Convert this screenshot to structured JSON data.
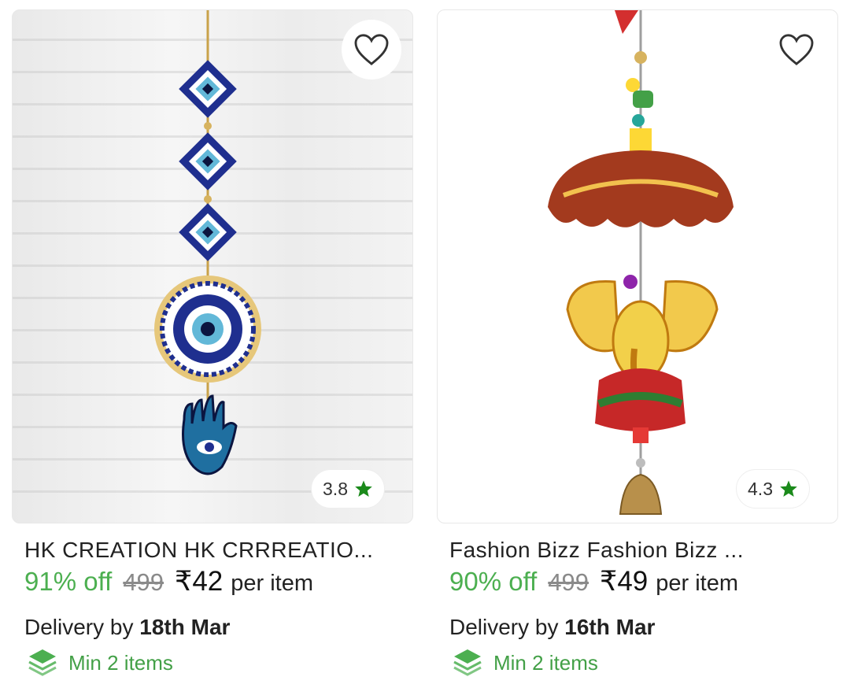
{
  "products": [
    {
      "title": "HK CREATION HK CRRREATIO...",
      "rating": "3.8",
      "discount": "91% off",
      "mrp": "499",
      "price": "₹42",
      "unit": "per item",
      "delivery_prefix": "Delivery by",
      "delivery_date": "18th Mar",
      "min_items": "Min 2 items",
      "image_icon": "evil-eye-hanging-image"
    },
    {
      "title": "Fashion Bizz Fashion Bizz ...",
      "rating": "4.3",
      "discount": "90% off",
      "mrp": "499",
      "price": "₹49",
      "unit": "per item",
      "delivery_prefix": "Delivery by",
      "delivery_date": "16th Mar",
      "min_items": "Min 2 items",
      "image_icon": "ganesha-bell-hanging-image"
    }
  ],
  "colors": {
    "discount": "#4caf50",
    "rating_star": "#1b8a1b",
    "min_items": "#43a047"
  }
}
